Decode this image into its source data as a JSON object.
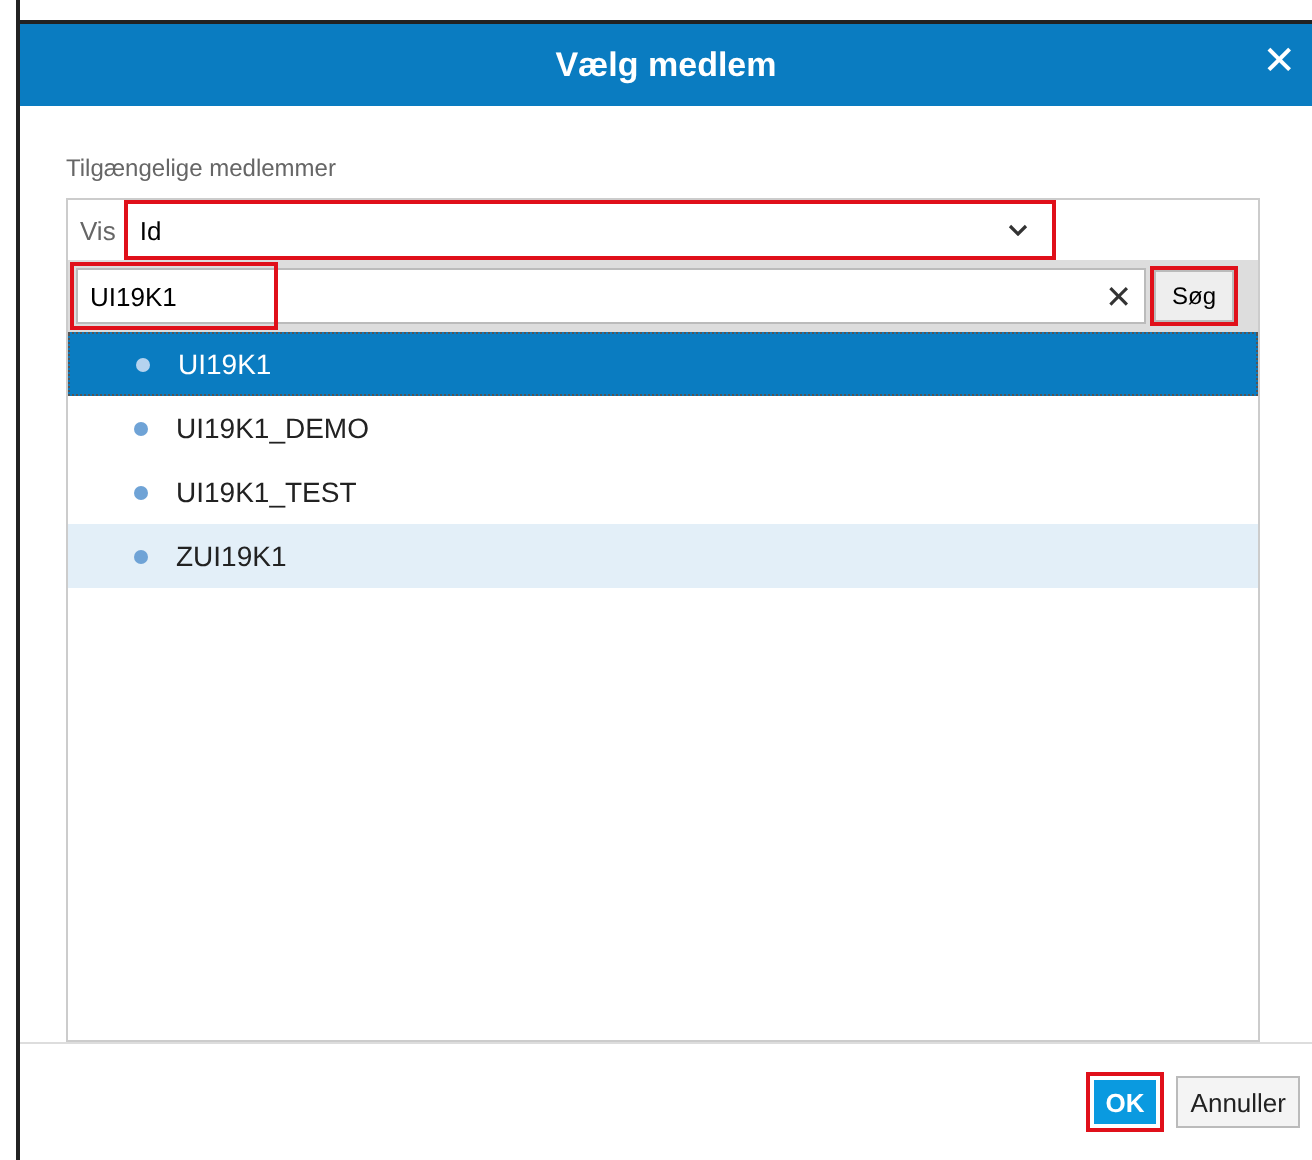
{
  "dialog": {
    "title": "Vælg medlem",
    "close": "✕"
  },
  "section_label": "Tilgængelige medlemmer",
  "show": {
    "label": "Vis",
    "value": "Id",
    "highlighted": true
  },
  "search": {
    "value": "UI19K1",
    "clear": "✕",
    "button": "Søg",
    "field_highlighted": true,
    "button_highlighted": true
  },
  "members": [
    {
      "name": "UI19K1",
      "selected": true,
      "hovered": false
    },
    {
      "name": "UI19K1_DEMO",
      "selected": false,
      "hovered": false
    },
    {
      "name": "UI19K1_TEST",
      "selected": false,
      "hovered": false
    },
    {
      "name": "ZUI19K1",
      "selected": false,
      "hovered": true
    }
  ],
  "buttons": [
    {
      "label": "OK",
      "kind": "primary",
      "highlighted": true
    },
    {
      "label": "Annuller",
      "kind": "secondary",
      "highlighted": false
    }
  ]
}
